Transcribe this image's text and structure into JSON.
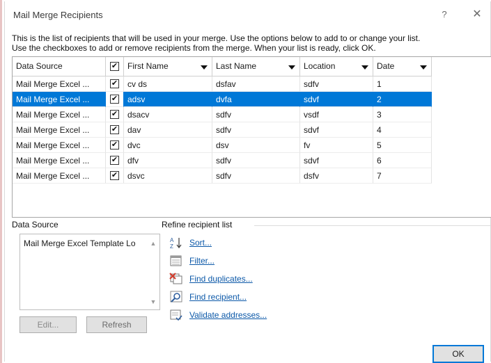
{
  "window": {
    "title": "Mail Merge Recipients",
    "help_label": "?",
    "close_label": "✕"
  },
  "description": {
    "line1": "This is the list of recipients that will be used in your merge.  Use the options below to add to or change your list.",
    "line2": "Use the checkboxes to add or remove recipients from the merge.  When your list is ready, click OK."
  },
  "table": {
    "columns": [
      "Data Source",
      "",
      "First Name",
      "Last Name",
      "Location",
      "Date"
    ],
    "header_checkbox": "✔",
    "rows": [
      {
        "source": "Mail Merge Excel ...",
        "checked": "✔",
        "first": "cv ds",
        "last": "dsfav",
        "location": "sdfv",
        "date": "1"
      },
      {
        "source": "Mail Merge Excel ...",
        "checked": "✔",
        "first": "adsv",
        "last": "dvfa",
        "location": "sdvf",
        "date": "2"
      },
      {
        "source": "Mail Merge Excel ...",
        "checked": "✔",
        "first": "dsacv",
        "last": "sdfv",
        "location": "vsdf",
        "date": "3"
      },
      {
        "source": "Mail Merge Excel ...",
        "checked": "✔",
        "first": "dav",
        "last": "sdfv",
        "location": "sdvf",
        "date": "4"
      },
      {
        "source": "Mail Merge Excel ...",
        "checked": "✔",
        "first": "dvc",
        "last": "dsv",
        "location": "fv",
        "date": "5"
      },
      {
        "source": "Mail Merge Excel ...",
        "checked": "✔",
        "first": "dfv",
        "last": "sdfv",
        "location": "sdvf",
        "date": "6"
      },
      {
        "source": "Mail Merge Excel ...",
        "checked": "✔",
        "first": "dsvc",
        "last": "sdfv",
        "location": "dsfv",
        "date": "7"
      }
    ],
    "selected_row": 2
  },
  "data_source": {
    "label": "Data Source",
    "items": [
      "Mail Merge Excel Template Lo"
    ],
    "edit_label": "Edit...",
    "refresh_label": "Refresh"
  },
  "refine": {
    "label": "Refine recipient list",
    "items": [
      {
        "label": "Sort...",
        "icon": "sort-az-icon"
      },
      {
        "label": "Filter...",
        "icon": "filter-icon"
      },
      {
        "label": "Find duplicates...",
        "icon": "find-duplicates-icon"
      },
      {
        "label": "Find recipient...",
        "icon": "find-recipient-icon"
      },
      {
        "label": "Validate addresses...",
        "icon": "validate-addresses-icon"
      }
    ]
  },
  "ok_label": "OK",
  "colors": {
    "selection": "#0078d7",
    "link": "#0b58a8"
  }
}
